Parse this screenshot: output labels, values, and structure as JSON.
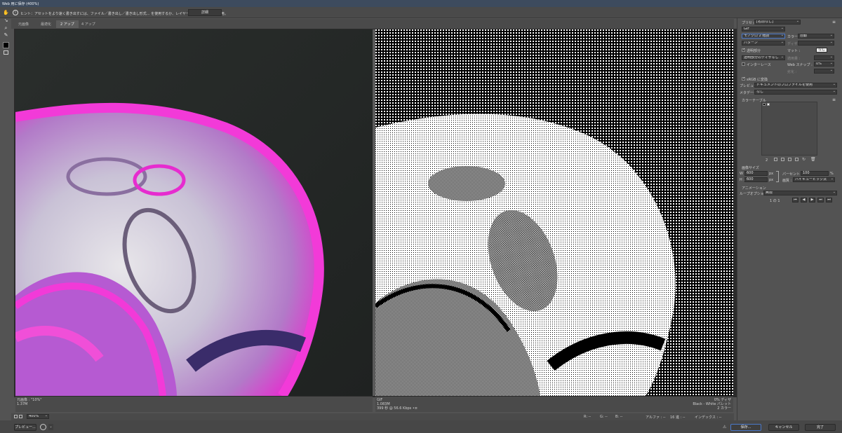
{
  "window": {
    "title": "Web 用に保存 (400%)"
  },
  "hint": {
    "text": "ヒント：アセットをより速く書き出すには、ファイル／書き出し／書き出し形式... を使用するか、レイヤーを右クリックして使用。",
    "more_button": "詳細"
  },
  "tools": [
    "hand-icon",
    "slice-select-icon",
    "zoom-icon",
    "eyedropper-icon",
    "eyedropper-color-icon",
    "toggle-slices-icon"
  ],
  "tabs": [
    "元画像",
    "最適化",
    "2 アップ",
    "4 アップ"
  ],
  "active_tab": 2,
  "left_info": {
    "name": "元画像 : \"10%\"",
    "size": "1.37M"
  },
  "right_info": {
    "format": "GIF",
    "size": "1.083M",
    "time": "399 秒 @ 56.6 Kbps",
    "menu": "•≡",
    "dither": "0% ディザ",
    "palette": "Black - White パレット",
    "colors": "2 カラー"
  },
  "status": {
    "zoom": "400%",
    "r": "R: --",
    "g": "G: --",
    "b": "B: --",
    "alpha": "アルファ : --",
    "hex": "16 進 : --",
    "index": "インデックス : --"
  },
  "buttons": {
    "preview": "プレビュー...",
    "save": "保存...",
    "cancel": "キャンセル",
    "done": "完了"
  },
  "panel": {
    "preset_label": "プリセット :",
    "preset_value": "[名前なし]",
    "format": "GIF",
    "reduction": "モノクロ 2 階調",
    "colors_label": "カラー :",
    "colors_value": "自動",
    "dither_method": "パターン",
    "dither_label": "ディザ :",
    "dither_value": "",
    "transparency_label": "透明部分",
    "matte_label": "マット :",
    "matte_value": "なし",
    "trans_dither": "透明部分のディザなし",
    "amount_label": "適用量 :",
    "amount_value": "",
    "interlace_label": "インターレース",
    "websnap_label": "Web スナップ :",
    "websnap_value": "0%",
    "lossy_label": "劣化 :",
    "lossy_value": "",
    "srgb_label": "sRGB に変換",
    "preview_label": "プレビュー :",
    "preview_value": "ドキュメントのプロファイルを使用",
    "metadata_label": "メタデータ :",
    "metadata_value": "なし",
    "colortable_label": "カラーテーブル",
    "colortable_count": "2",
    "imagesize_label": "画像サイズ",
    "w_label": "W :",
    "w_value": "600",
    "w_unit": "px",
    "h_label": "H :",
    "h_value": "600",
    "h_unit": "px",
    "percent_label": "パーセント :",
    "percent_value": "100",
    "percent_unit": "%",
    "quality_label": "画質 :",
    "quality_value": "バイキュービック法",
    "animation_label": "アニメーション",
    "loop_label": "ループオプション :",
    "loop_value": "無限",
    "frame_counter": "1 の 1"
  },
  "colors": {
    "accent": "#4a78c8",
    "magenta": "#e62ccf"
  }
}
